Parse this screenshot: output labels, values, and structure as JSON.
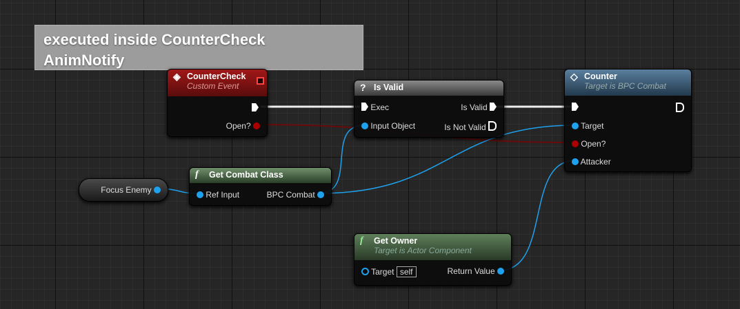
{
  "comment": {
    "text": "executed inside CounterCheck AnimNotify"
  },
  "counter_check": {
    "title": "CounterCheck",
    "subtitle": "Custom Event",
    "pin_open": "Open?"
  },
  "is_valid": {
    "title": "Is Valid",
    "icon": "?",
    "pin_exec": "Exec",
    "pin_input": "Input Object",
    "pin_valid": "Is Valid",
    "pin_not_valid": "Is Not Valid"
  },
  "counter": {
    "title": "Counter",
    "subtitle": "Target is BPC Combat",
    "pin_target": "Target",
    "pin_open": "Open?",
    "pin_attacker": "Attacker"
  },
  "get_combat_class": {
    "title": "Get Combat Class",
    "icon": "f",
    "pin_in": "Ref Input",
    "pin_out": "BPC Combat"
  },
  "focus_enemy": {
    "label": "Focus Enemy"
  },
  "get_owner": {
    "title": "Get Owner",
    "icon": "f",
    "subtitle": "Target is Actor Component",
    "pin_target": "Target",
    "pin_target_default": "self",
    "pin_return": "Return Value"
  }
}
